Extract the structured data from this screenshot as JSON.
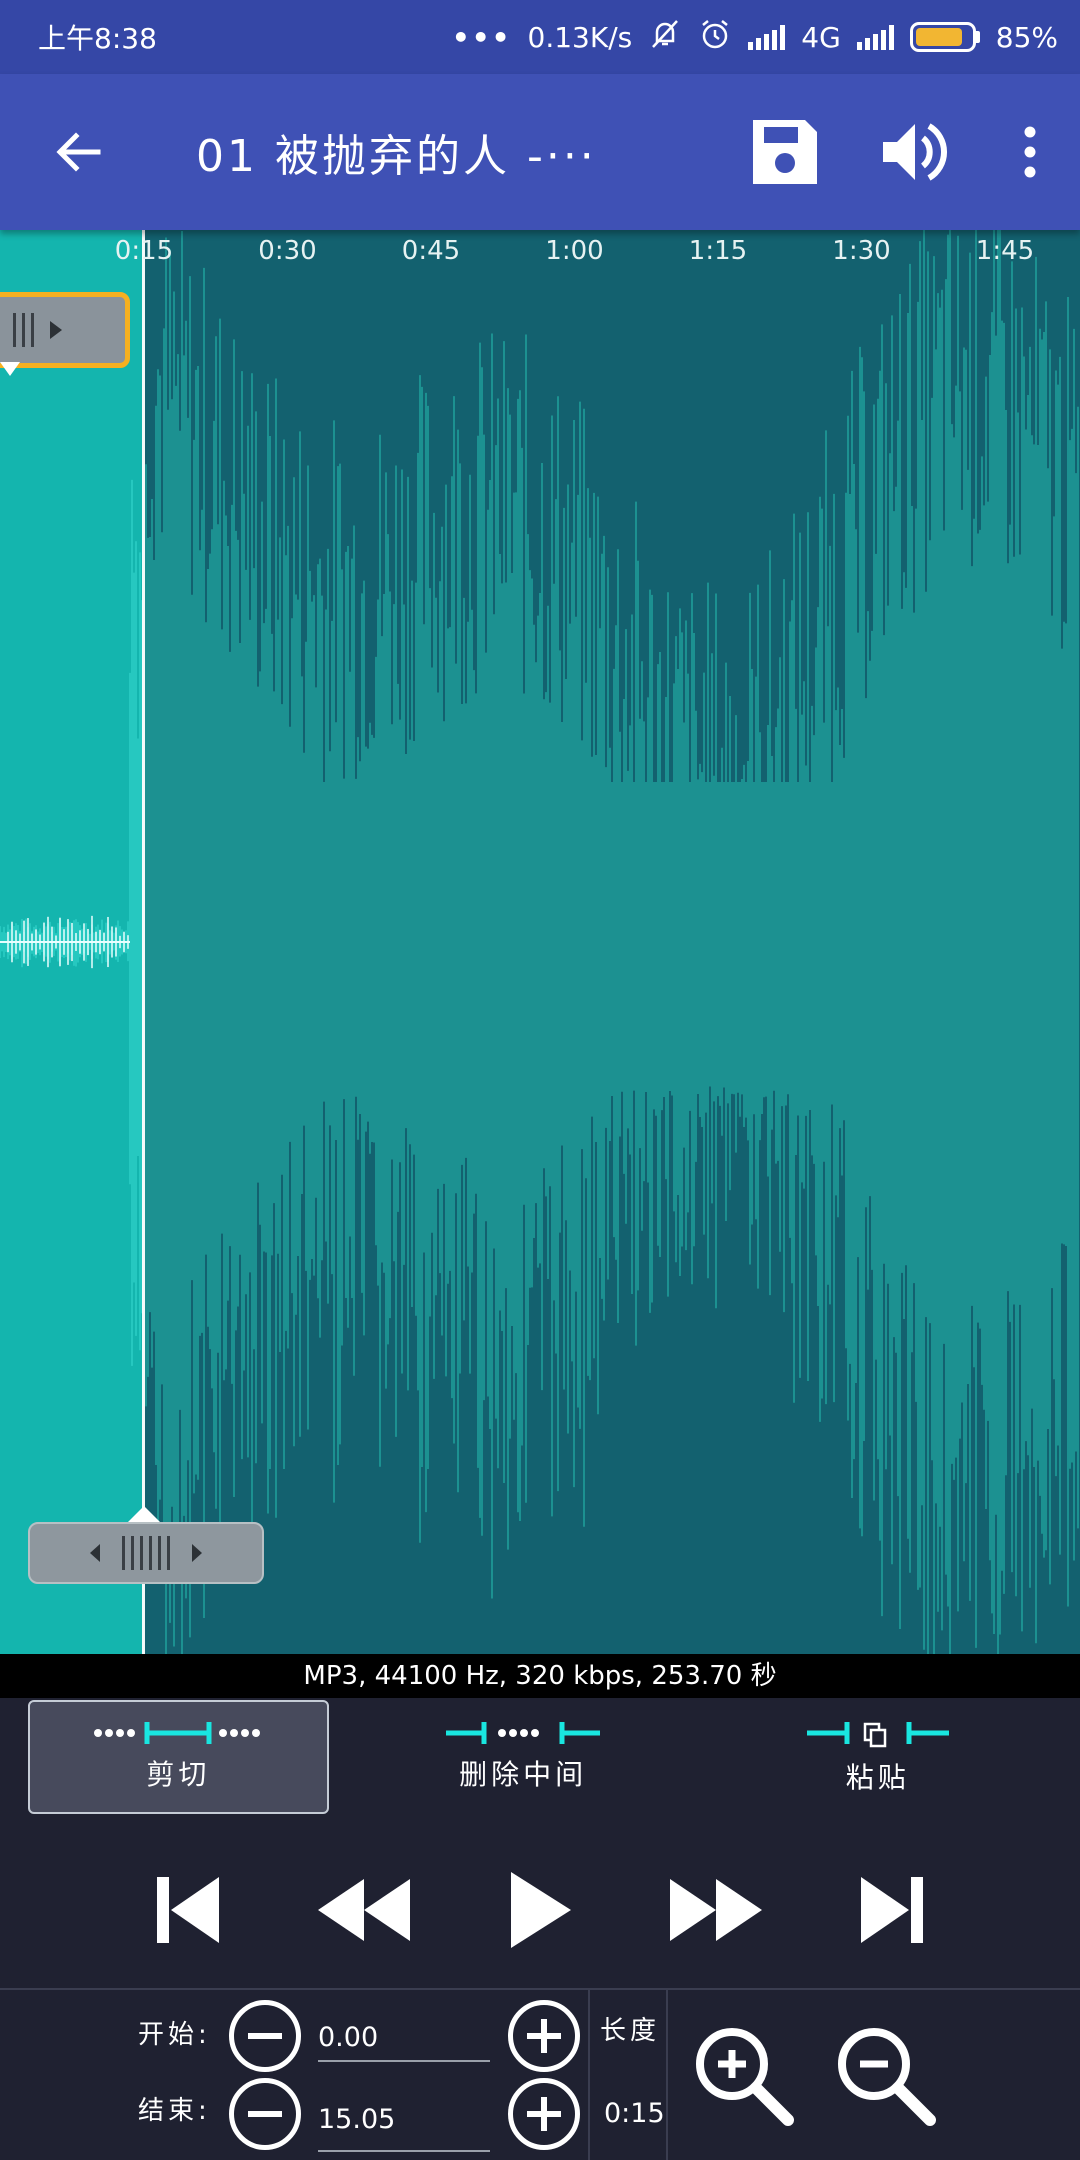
{
  "status_bar": {
    "time": "上午8:38",
    "dots": "•••",
    "net_speed": "0.13K/s",
    "network": "4G",
    "battery": "85%",
    "battery_level": 0.85
  },
  "app_bar": {
    "title": "01 被抛弃的人 -···",
    "icons": [
      "back-arrow-icon",
      "save-floppy-icon",
      "volume-icon",
      "more-vert-icon"
    ]
  },
  "timeline": {
    "ticks": [
      "0:15",
      "0:30",
      "0:45",
      "1:00",
      "1:15",
      "1:30",
      "1:45"
    ]
  },
  "info": {
    "text": "MP3, 44100 Hz, 320 kbps, 253.70 秒"
  },
  "modes": [
    {
      "label": "剪切",
      "active": true
    },
    {
      "label": "删除中间",
      "active": false
    },
    {
      "label": "粘贴",
      "active": false
    }
  ],
  "transport": [
    "skip-to-start-icon",
    "rewind-icon",
    "play-icon",
    "fast-forward-icon",
    "skip-to-end-icon"
  ],
  "trim": {
    "start_label": "开始:",
    "start_value": "0.00",
    "end_label": "结束:",
    "end_value": "15.05",
    "length_label": "长度",
    "length_value": "0:15"
  },
  "colors": {
    "status_bar": "#3547a6",
    "app_bar": "#3f51b5",
    "wave_bg": "#13616f",
    "wave_fg": "#1e9a98",
    "selection": "#14b5ae",
    "accent": "#19e6e0",
    "handle_border": "#f5b020",
    "panel": "#1f2131"
  }
}
